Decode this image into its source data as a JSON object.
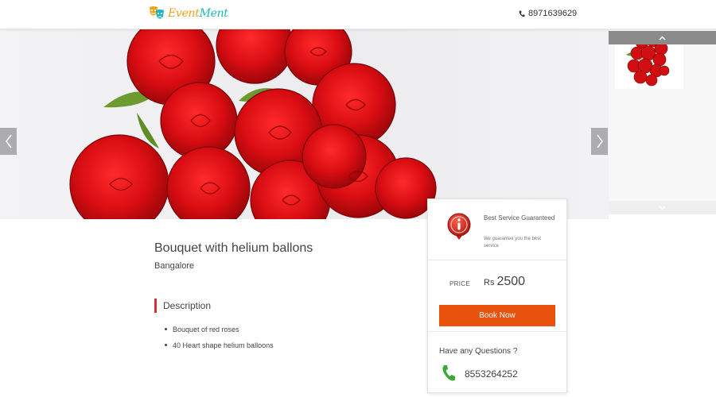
{
  "header": {
    "logo_part1": "Event",
    "logo_part2": "Ment",
    "phone": "8971639629"
  },
  "hero": {
    "image_alt": "Bouquet of red roses"
  },
  "product": {
    "title": "Bouquet with helium ballons",
    "city": "Bangalore",
    "description_heading": "Description",
    "description_items": [
      "Bouquet of red roses",
      "40 Heart shape helium balloons"
    ]
  },
  "card": {
    "guarantee_title": "Best Service Guaranteed",
    "guarantee_text": "We guarantee you the best service",
    "price_label": "PRICE",
    "currency": "Rs",
    "price": "2500",
    "book_label": "Book Now",
    "questions_label": "Have any Questions ?",
    "contact_phone": "8553264252"
  },
  "colors": {
    "accent": "#e8520d",
    "desc_bar": "#d9312b",
    "info_icon": "#d9312b",
    "phone_icon": "#3aaa35"
  }
}
